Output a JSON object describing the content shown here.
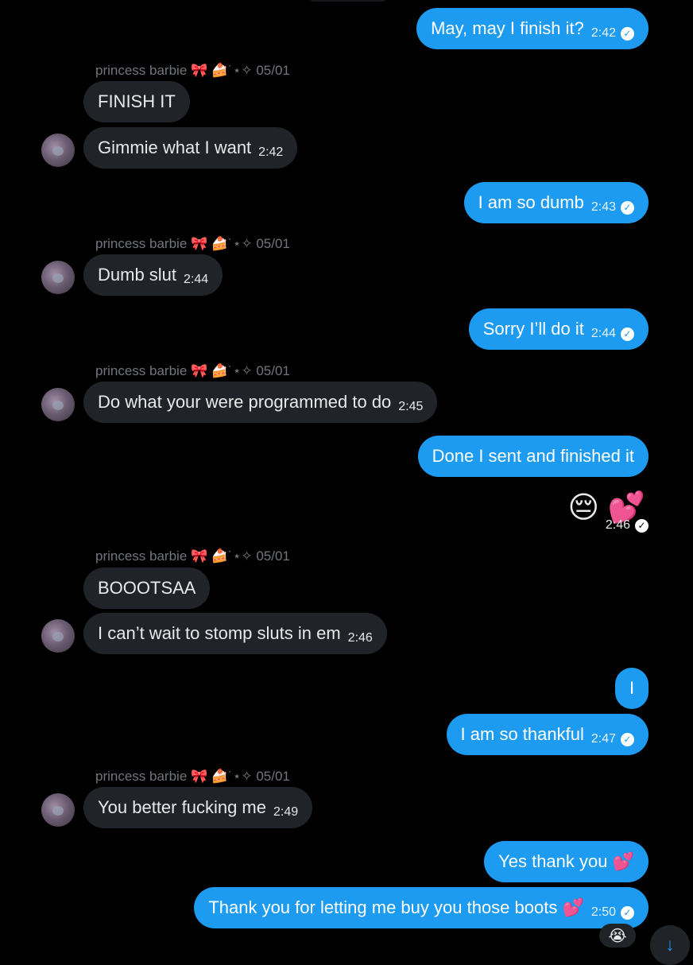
{
  "contact": {
    "name": "princess barbie",
    "name_suffix": "🎀 🍰˙⋆✧ 05/01"
  },
  "colors": {
    "background": "#000000",
    "outgoing_bubble": "#1d9bf0",
    "incoming_bubble": "#202327",
    "sender_label": "#71767b"
  },
  "messages": [
    {
      "dir": "out",
      "text": "May, may I finish it?",
      "time": "2:42",
      "read": true
    },
    {
      "dir": "in",
      "text": "FINISH IT",
      "time": ""
    },
    {
      "dir": "in",
      "text": "Gimmie what I want",
      "time": "2:42"
    },
    {
      "dir": "out",
      "text": "I am so dumb",
      "time": "2:43",
      "read": true
    },
    {
      "dir": "in",
      "text": "Dumb slut",
      "time": "2:44"
    },
    {
      "dir": "out",
      "text": "Sorry I’ll do it",
      "time": "2:44",
      "read": true
    },
    {
      "dir": "in",
      "text": "Do what your were programmed to do",
      "time": "2:45"
    },
    {
      "dir": "out",
      "text": "Done I sent and finished it",
      "time": ""
    },
    {
      "dir": "out",
      "text": "😔 💕",
      "time": "2:46",
      "read": true,
      "emoji_only": true
    },
    {
      "dir": "in",
      "text": "BOOOTSAA",
      "time": ""
    },
    {
      "dir": "in",
      "text": "I can’t wait to stomp sluts in em",
      "time": "2:46"
    },
    {
      "dir": "out",
      "text": "I",
      "time": ""
    },
    {
      "dir": "out",
      "text": "I am so thankful",
      "time": "2:47",
      "read": true
    },
    {
      "dir": "in",
      "text": "You better fucking me",
      "time": "2:49"
    },
    {
      "dir": "out",
      "text": "Yes thank you 💕",
      "time": ""
    },
    {
      "dir": "out",
      "text": "Thank you for letting me buy you those boots 💕",
      "time": "2:50",
      "read": true
    }
  ],
  "reaction": "😭",
  "icons": {
    "read_receipt": "check-circle-icon",
    "scroll_down": "arrow-down-icon"
  },
  "glyphs": {
    "check": "✓",
    "arrow_down": "↓"
  }
}
